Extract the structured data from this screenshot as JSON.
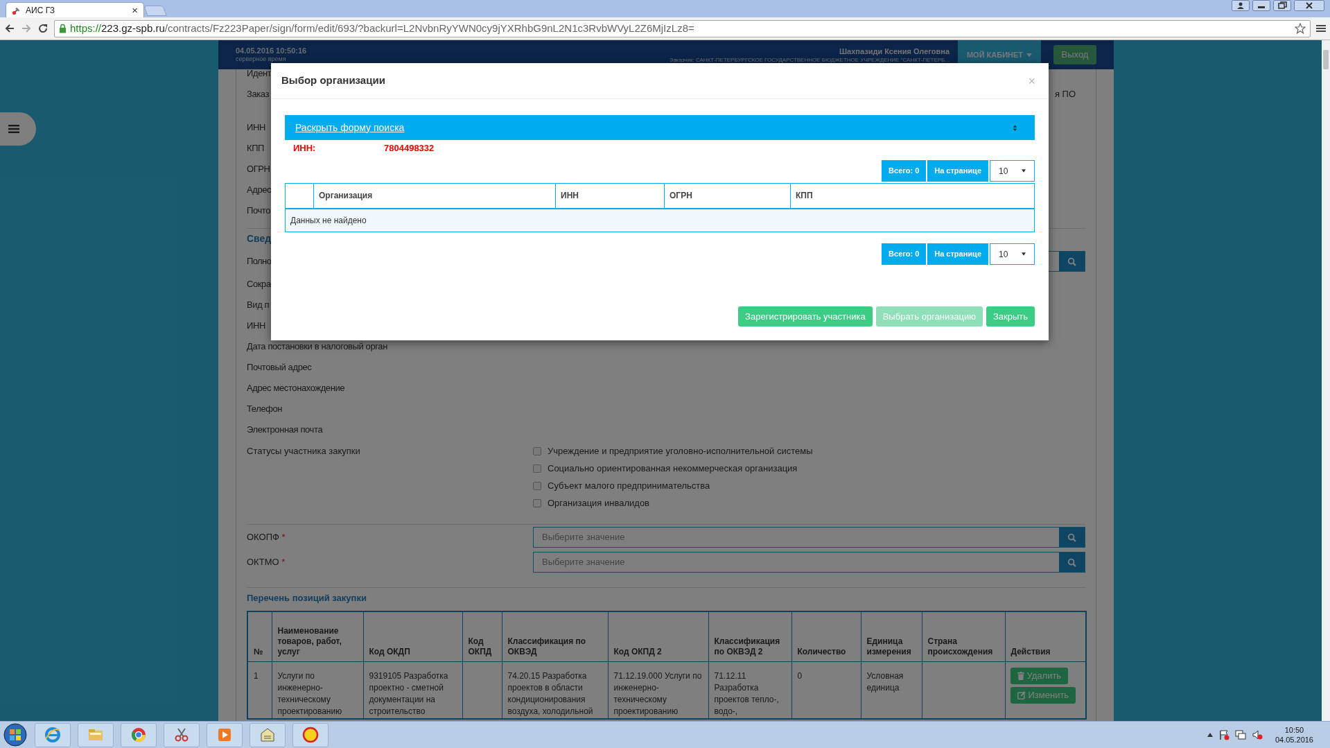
{
  "browser": {
    "tab": {
      "title": "АИС ГЗ",
      "close": "×"
    },
    "url": {
      "scheme": "https://",
      "host": "223.gz-spb.ru",
      "path": "/contracts/Fz223Paper/sign/form/edit/693/?backurl=L2NvbnRyYWN0cy9jYXRhbG9nL2N1c3RvbWVyL2Z6MjIzLz8="
    }
  },
  "header": {
    "server_time": "04.05.2016 10:50:16",
    "server_time_caption": "серверное время",
    "user_name": "Шахпазиди Ксения Олеговна",
    "customer": "Заказчик: САНКТ-ПЕТЕРБУРГСКОЕ ГОСУДАРСТВЕННОЕ БЮДЖЕТНОЕ УЧРЕЖДЕНИЕ \"САНКТ-ПЕТЕРБ...",
    "cabinet_button": "МОЙ КАБИНЕТ",
    "logout_button": "Выход"
  },
  "form": {
    "top_rows": [
      {
        "label": "Идент"
      },
      {
        "label": "Заказ",
        "value": "я ПО"
      },
      {
        "label": "ИНН"
      },
      {
        "label": "КПП"
      },
      {
        "label": "ОГРН"
      },
      {
        "label": "Адрес"
      },
      {
        "label": "Почто"
      }
    ],
    "section_title": "Свед",
    "section_rows": [
      {
        "label": "Полно",
        "kind": "lookup"
      },
      {
        "label": "Сокра",
        "kind": "text"
      },
      {
        "label": "Вид п",
        "kind": "text"
      },
      {
        "label": "ИНН",
        "kind": "text"
      },
      {
        "label": "Дата постановки в налоговый орган",
        "kind": "text"
      },
      {
        "label": "Почтовый адрес",
        "kind": "text"
      },
      {
        "label": "Адрес местонахождение",
        "kind": "text"
      },
      {
        "label": "Телефон",
        "kind": "text"
      },
      {
        "label": "Электронная почта",
        "kind": "text"
      }
    ],
    "statuses": {
      "label": "Статусы участника закупки",
      "options": [
        {
          "label": "Учреждение и предприятие уголовно-исполнительной системы",
          "checked": false
        },
        {
          "label": "Социально ориентированная некоммерческая организация",
          "checked": false
        },
        {
          "label": "Субъект малого предпринимательства",
          "checked": false
        },
        {
          "label": "Организация инвалидов",
          "checked": false
        }
      ]
    },
    "lookups": [
      {
        "label": "ОКОПФ",
        "required_mark": "*",
        "placeholder": "Выберите значение"
      },
      {
        "label": "ОКТМО",
        "required_mark": "*",
        "placeholder": "Выберите значение"
      }
    ]
  },
  "positions": {
    "title": "Перечень позиций закупки",
    "columns": [
      "№",
      "Наименование товаров, работ, услуг",
      "Код ОКДП",
      "Код ОКПД",
      "Классификация по ОКВЭД",
      "Код ОКПД 2",
      "Классификация по ОКВЭД 2",
      "Количество",
      "Единица измерения",
      "Страна происхождения",
      "Действия"
    ],
    "rows": [
      {
        "cells": [
          "1",
          "Услуги по инженерно-техническому проектированию",
          "9319105 Разработка проектно - сметной документации на строительство",
          null,
          "74.20.15 Разработка проектов в области кондиционирования воздуха, холодильной",
          "71.12.19.000 Услуги по инженерно-техническому проектированию",
          "71.12.11 Разработка проектов тепло-, водо-,",
          "0",
          "Условная единица",
          null
        ],
        "actions": [
          {
            "kind": "delete",
            "label": "Удалить"
          },
          {
            "kind": "edit",
            "label": "Изменить"
          }
        ]
      }
    ]
  },
  "modal": {
    "title": "Выбор организации",
    "close": "×",
    "search_toggle": "Раскрыть форму поиска",
    "filter": {
      "label": "ИНН:",
      "value": "7804498332"
    },
    "pager_top": {
      "total": "Всего: 0",
      "per_page_label": "На странице",
      "per_page": "10"
    },
    "columns": [
      "Организация",
      "ИНН",
      "ОГРН",
      "КПП"
    ],
    "empty_message": "Данных не найдено",
    "pager_bottom": {
      "total": "Всего: 0",
      "per_page_label": "На странице",
      "per_page": "10"
    },
    "buttons": [
      {
        "label": "Зарегистрировать участника",
        "disabled": false
      },
      {
        "label": "Выбрать организацию",
        "disabled": true
      },
      {
        "label": "Закрыть",
        "disabled": false
      }
    ]
  },
  "taskbar": {
    "clock": {
      "time": "10:50",
      "date": "04.05.2016"
    }
  }
}
